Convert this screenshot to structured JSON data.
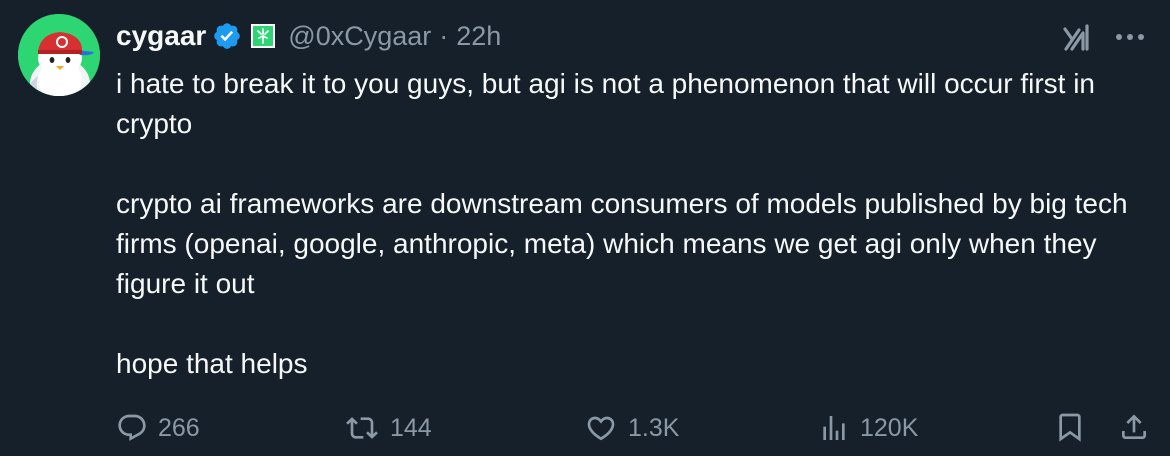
{
  "author": {
    "display_name": "cygaar",
    "handle": "@0xCygaar",
    "separator": "·",
    "time": "22h"
  },
  "icons": {
    "verified": "verified-badge-icon",
    "affiliation": "affiliation-badge-icon",
    "grok": "grok-icon",
    "more": "more-options-icon"
  },
  "colors": {
    "background": "#15202b",
    "text": "#f7f9f9",
    "muted": "#8b98a5",
    "verified": "#1d9bf0",
    "avatar_bg": "#2ed573"
  },
  "tweet": {
    "paragraphs": [
      "i hate to break it to you guys, but agi is not a phenomenon that will occur first in crypto",
      "crypto ai frameworks are downstream consumers of models published by big tech firms (openai, google, anthropic, meta) which means we get agi only when they figure it out",
      "hope that helps"
    ]
  },
  "actions": {
    "replies": "266",
    "reposts": "144",
    "likes": "1.3K",
    "views": "120K"
  }
}
